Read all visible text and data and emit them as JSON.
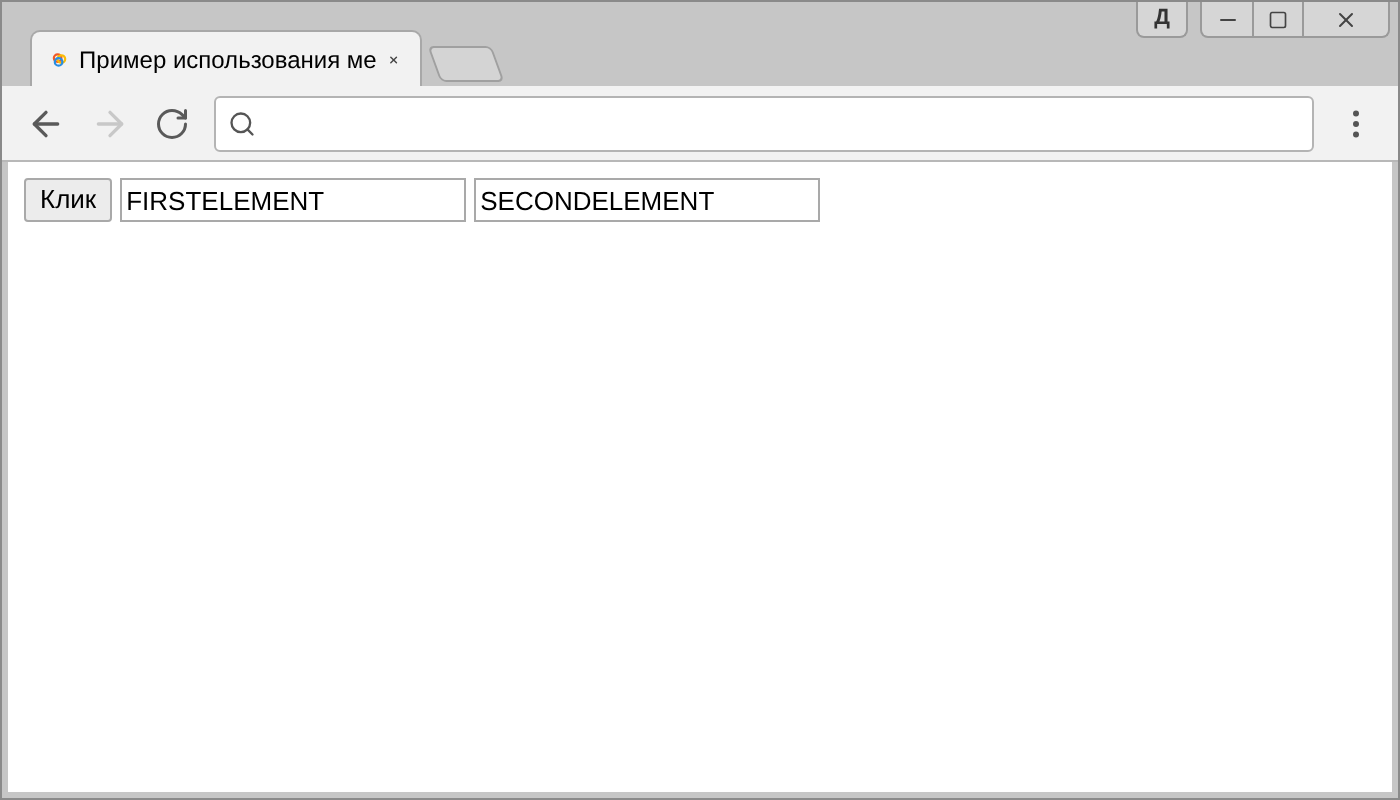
{
  "window": {
    "profile_badge": "Д"
  },
  "tabs": [
    {
      "title": "Пример использования ме",
      "selected": true
    }
  ],
  "toolbar": {
    "back": {
      "disabled": false
    },
    "forward": {
      "disabled": true
    }
  },
  "page": {
    "button": "Клик",
    "fields": [
      {
        "value": "FIRSTELEMENT"
      },
      {
        "value": "SECONDELEMENT"
      }
    ]
  }
}
